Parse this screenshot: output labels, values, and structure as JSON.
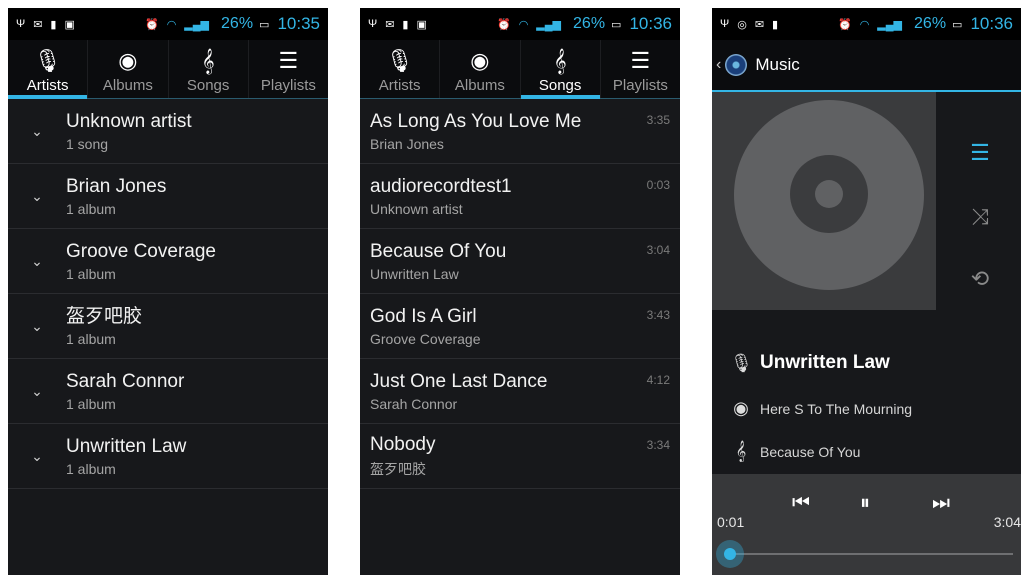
{
  "status_left": {
    "clock": "10:35",
    "battery": "26%"
  },
  "status_mid": {
    "clock": "10:36",
    "battery": "26%"
  },
  "status_right": {
    "clock": "10:36",
    "battery": "26%"
  },
  "tabs_left": [
    "Artists",
    "Albums",
    "Songs",
    "Playlists"
  ],
  "tabs_mid": [
    "Artists",
    "Albums",
    "Songs",
    "Playlists"
  ],
  "artists": [
    {
      "name": "Unknown artist",
      "sub": "1 song"
    },
    {
      "name": "Brian Jones",
      "sub": "1 album"
    },
    {
      "name": "Groove Coverage",
      "sub": "1 album"
    },
    {
      "name": "盔歹吧胶",
      "sub": "1 album"
    },
    {
      "name": "Sarah Connor",
      "sub": "1 album"
    },
    {
      "name": "Unwritten Law",
      "sub": "1 album"
    }
  ],
  "songs": [
    {
      "title": "As Long As You Love Me",
      "artist": "Brian Jones",
      "duration": "3:35"
    },
    {
      "title": "audiorecordtest1",
      "artist": "Unknown artist",
      "duration": "0:03"
    },
    {
      "title": "Because Of You",
      "artist": "Unwritten Law",
      "duration": "3:04"
    },
    {
      "title": "God Is A Girl",
      "artist": "Groove Coverage",
      "duration": "3:43"
    },
    {
      "title": "Just One Last Dance",
      "artist": "Sarah Connor",
      "duration": "4:12"
    },
    {
      "title": "Nobody",
      "artist": "盔歹吧胶",
      "duration": "3:34"
    }
  ],
  "player": {
    "app_title": "Music",
    "artist": "Unwritten Law",
    "album": "Here S To The Mourning",
    "song": "Because Of You",
    "elapsed": "0:01",
    "total": "3:04"
  },
  "icons": {
    "artists_tab": "microphone-icon",
    "albums_tab": "disc-icon",
    "songs_tab": "treble-clef-icon",
    "playlists_tab": "list-icon"
  },
  "colors": {
    "accent": "#33b5e5",
    "background": "#17181b"
  }
}
